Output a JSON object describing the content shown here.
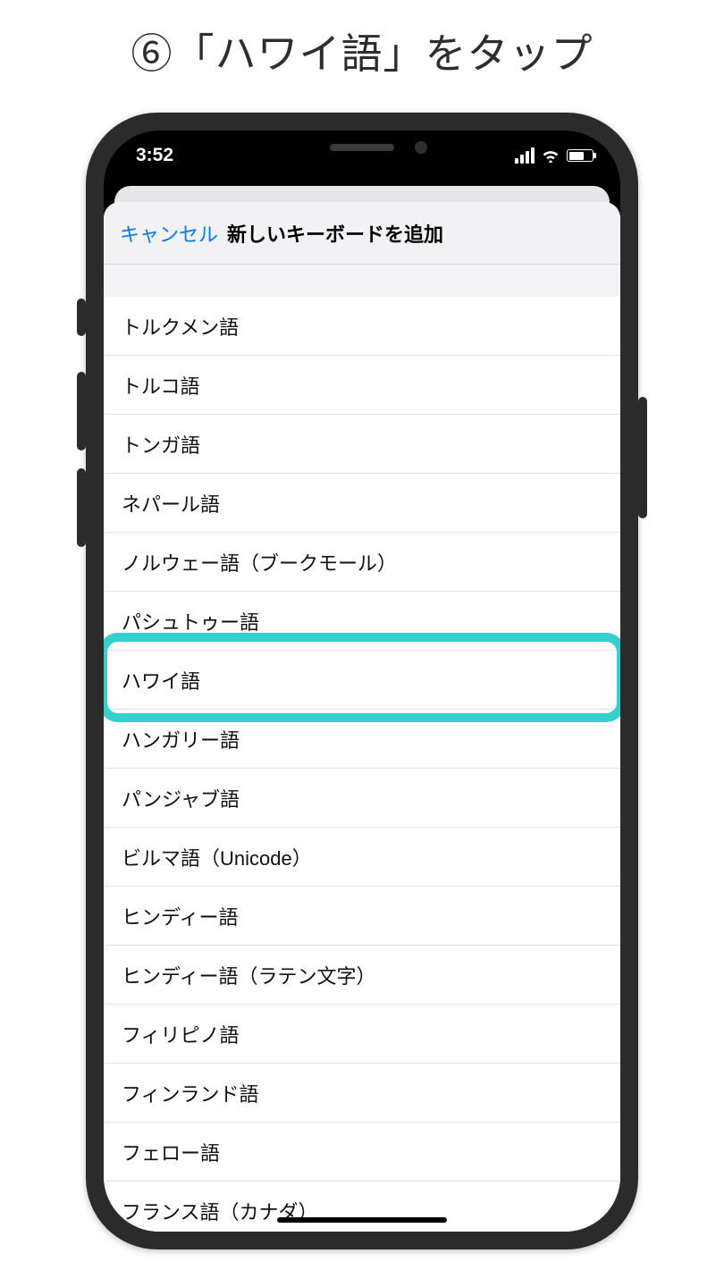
{
  "caption": "⑥「ハワイ語」をタップ",
  "status": {
    "time": "3:52"
  },
  "sheet": {
    "cancel": "キャンセル",
    "title": "新しいキーボードを追加"
  },
  "rows": [
    "トルクメン語",
    "トルコ語",
    "トンガ語",
    "ネパール語",
    "ノルウェー語（ブークモール）",
    "パシュトゥー語",
    "ハワイ語",
    "ハンガリー語",
    "パンジャブ語",
    "ビルマ語（Unicode）",
    "ヒンディー語",
    "ヒンディー語（ラテン文字）",
    "フィリピノ語",
    "フィンランド語",
    "フェロー語",
    "フランス語（カナダ）"
  ],
  "highlight_index": 6,
  "colors": {
    "accent": "#007aff",
    "highlight": "#34d0cf"
  }
}
